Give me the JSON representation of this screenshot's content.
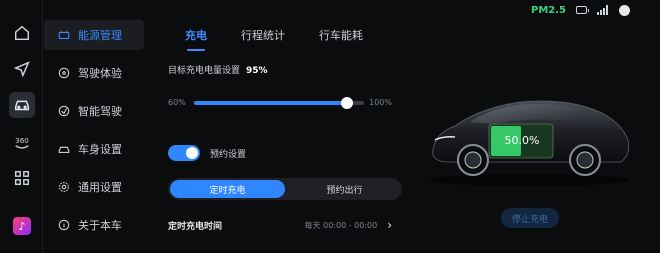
{
  "status": {
    "pm": "PM2.5"
  },
  "rail": {
    "icons": [
      "home-icon",
      "navigation-icon",
      "car-icon",
      "360-view-icon",
      "apps-grid-icon",
      "music-app-icon"
    ],
    "label_360": "360"
  },
  "menu": {
    "items": [
      {
        "label": "能源管理",
        "icon": "battery-icon",
        "active": true
      },
      {
        "label": "驾驶体验",
        "icon": "steering-wheel-icon"
      },
      {
        "label": "智能驾驶",
        "icon": "driver-assist-icon"
      },
      {
        "label": "车身设置",
        "icon": "car-body-icon"
      },
      {
        "label": "通用设置",
        "icon": "settings-icon"
      },
      {
        "label": "关于本车",
        "icon": "info-icon"
      }
    ]
  },
  "tabs": [
    "充电",
    "行程统计",
    "行车能耗"
  ],
  "charge": {
    "target_label": "目标充电电量设置",
    "target_value": "95%",
    "slider_min": "60%",
    "slider_max": "100%",
    "slider_level": 0.9,
    "reserve_label": "预约设置",
    "reserve_on": true,
    "segments": [
      "定时充电",
      "预约出行"
    ],
    "schedule_label": "定时充电时间",
    "schedule_value": "每天 00:00 - 00:00",
    "battery_pct": "50.0%",
    "stop_label": "停止充电"
  },
  "colors": {
    "accent": "#2f86ff",
    "green": "#3ad07a"
  }
}
